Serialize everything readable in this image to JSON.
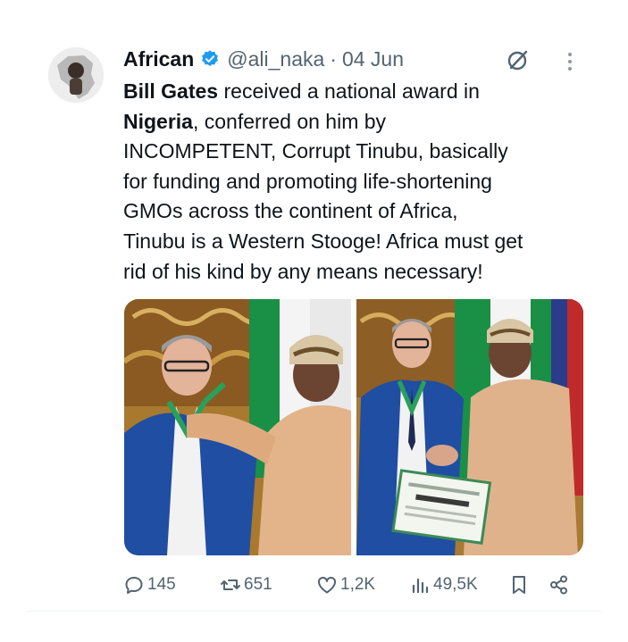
{
  "tweet": {
    "author_name": "African",
    "handle": "@ali_naka",
    "separator": "·",
    "date": "04 Jun",
    "text": {
      "l1_b": "Bill Gates",
      "l1": " received a national award in",
      "l2_b": "Nigeria",
      "l2": ", conferred on him by",
      "l3": "INCOMPETENT, Corrupt Tinubu, basically",
      "l4": "for funding and promoting life-shortening",
      "l5": "GMOs across the continent of Africa,",
      "l6": "Tinubu is a Western Stooge! Africa must get",
      "l7": "rid of his kind by any means necessary!"
    }
  },
  "actions": {
    "replies": "145",
    "retweets": "651",
    "likes": "1,2K",
    "views": "49,5K"
  },
  "icons": {
    "verified": "verified-badge-icon",
    "grok": "grok-icon",
    "more": "more-vertical-icon",
    "reply": "reply-icon",
    "retweet": "retweet-icon",
    "like": "heart-icon",
    "views": "views-icon",
    "bookmark": "bookmark-icon",
    "share": "share-icon"
  },
  "colors": {
    "text": "#0f1419",
    "secondary": "#536471",
    "verified": "#1d9bf0"
  }
}
